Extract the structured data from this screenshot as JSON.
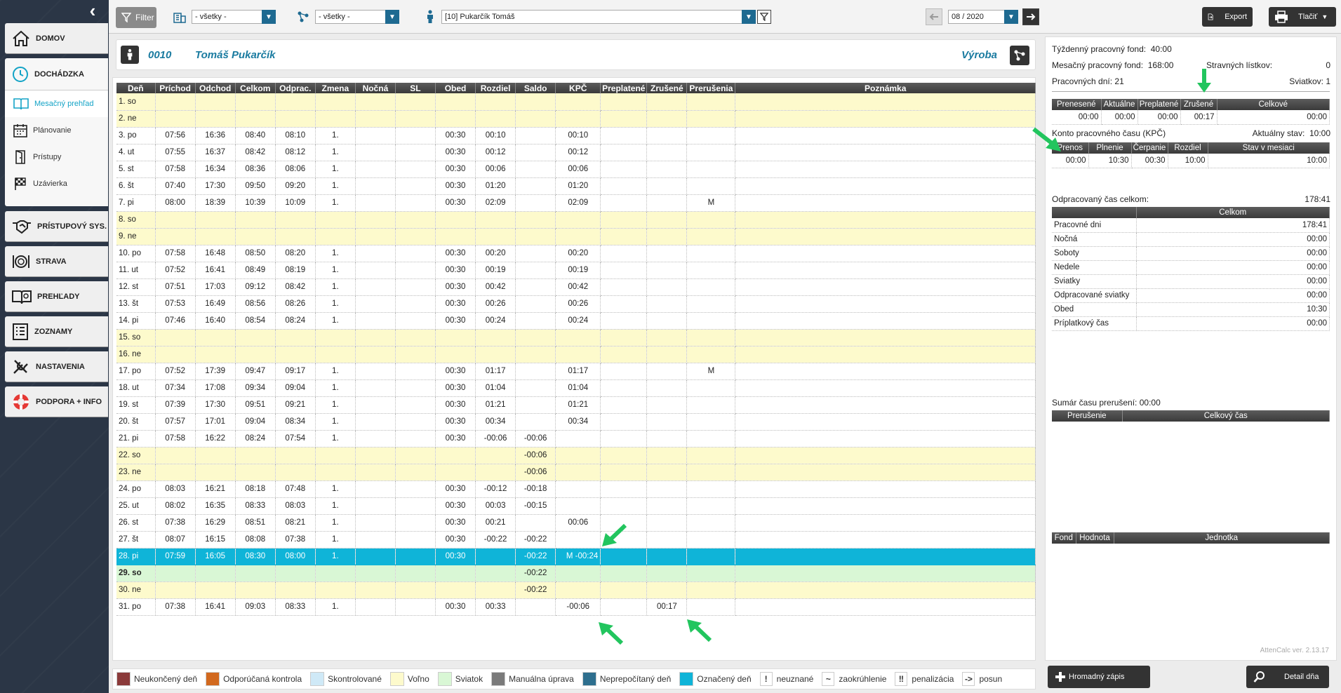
{
  "sidebar": {
    "home": "DOMOV",
    "attendance": "DOCHÁDZKA",
    "sub": [
      "Mesačný prehľad",
      "Plánovanie",
      "Prístupy",
      "Uzávierka"
    ],
    "access_system": "PRÍSTUPOVÝ SYS.",
    "food": "STRAVA",
    "reports": "PREHĽADY",
    "lists": "ZOZNAMY",
    "settings": "NASTAVENIA",
    "support": "PODPORA + INFO"
  },
  "toolbar": {
    "filter": "Filter",
    "org_select": "- všetky -",
    "group_select": "- všetky -",
    "employee_select": "[10] Pukarčík Tomáš",
    "period": "08 / 2020",
    "export": "Export",
    "print": "Tlačiť"
  },
  "employee": {
    "id": "0010",
    "name": "Tomáš Pukarčík",
    "dept": "Výroba"
  },
  "columns": [
    "Deň",
    "Príchod",
    "Odchod",
    "Celkom",
    "Odprac.",
    "Zmena",
    "Nočná",
    "SL",
    "Obed",
    "Rozdiel",
    "Saldo",
    "KPČ",
    "Preplatené",
    "Zrušené",
    "Prerušenia",
    "Poznámka"
  ],
  "rows": [
    {
      "t": "weekend",
      "c": [
        "1. so",
        "",
        "",
        "",
        "",
        "",
        "",
        "",
        "",
        "",
        "",
        "",
        "",
        "",
        "",
        ""
      ]
    },
    {
      "t": "weekend",
      "c": [
        "2. ne",
        "",
        "",
        "",
        "",
        "",
        "",
        "",
        "",
        "",
        "",
        "",
        "",
        "",
        "",
        ""
      ]
    },
    {
      "t": "",
      "c": [
        "3. po",
        "07:56",
        "16:36",
        "08:40",
        "08:10",
        "1.",
        "",
        "",
        "00:30",
        "00:10",
        "",
        "00:10",
        "",
        "",
        "",
        ""
      ]
    },
    {
      "t": "",
      "c": [
        "4. ut",
        "07:55",
        "16:37",
        "08:42",
        "08:12",
        "1.",
        "",
        "",
        "00:30",
        "00:12",
        "",
        "00:12",
        "",
        "",
        "",
        ""
      ]
    },
    {
      "t": "",
      "c": [
        "5. st",
        "07:58",
        "16:34",
        "08:36",
        "08:06",
        "1.",
        "",
        "",
        "00:30",
        "00:06",
        "",
        "00:06",
        "",
        "",
        "",
        ""
      ]
    },
    {
      "t": "",
      "c": [
        "6. št",
        "07:40",
        "17:30",
        "09:50",
        "09:20",
        "1.",
        "",
        "",
        "00:30",
        "01:20",
        "",
        "01:20",
        "",
        "",
        "",
        ""
      ]
    },
    {
      "t": "",
      "c": [
        "7. pi",
        "08:00",
        "18:39",
        "10:39",
        "10:09",
        "1.",
        "",
        "",
        "00:30",
        "02:09",
        "",
        "02:09",
        "",
        "",
        "M",
        ""
      ]
    },
    {
      "t": "weekend",
      "c": [
        "8. so",
        "",
        "",
        "",
        "",
        "",
        "",
        "",
        "",
        "",
        "",
        "",
        "",
        "",
        "",
        ""
      ]
    },
    {
      "t": "weekend",
      "c": [
        "9. ne",
        "",
        "",
        "",
        "",
        "",
        "",
        "",
        "",
        "",
        "",
        "",
        "",
        "",
        "",
        ""
      ]
    },
    {
      "t": "",
      "c": [
        "10. po",
        "07:58",
        "16:48",
        "08:50",
        "08:20",
        "1.",
        "",
        "",
        "00:30",
        "00:20",
        "",
        "00:20",
        "",
        "",
        "",
        ""
      ]
    },
    {
      "t": "",
      "c": [
        "11. ut",
        "07:52",
        "16:41",
        "08:49",
        "08:19",
        "1.",
        "",
        "",
        "00:30",
        "00:19",
        "",
        "00:19",
        "",
        "",
        "",
        ""
      ]
    },
    {
      "t": "",
      "c": [
        "12. st",
        "07:51",
        "17:03",
        "09:12",
        "08:42",
        "1.",
        "",
        "",
        "00:30",
        "00:42",
        "",
        "00:42",
        "",
        "",
        "",
        ""
      ]
    },
    {
      "t": "",
      "c": [
        "13. št",
        "07:53",
        "16:49",
        "08:56",
        "08:26",
        "1.",
        "",
        "",
        "00:30",
        "00:26",
        "",
        "00:26",
        "",
        "",
        "",
        ""
      ]
    },
    {
      "t": "",
      "c": [
        "14. pi",
        "07:46",
        "16:40",
        "08:54",
        "08:24",
        "1.",
        "",
        "",
        "00:30",
        "00:24",
        "",
        "00:24",
        "",
        "",
        "",
        ""
      ]
    },
    {
      "t": "weekend",
      "c": [
        "15. so",
        "",
        "",
        "",
        "",
        "",
        "",
        "",
        "",
        "",
        "",
        "",
        "",
        "",
        "",
        ""
      ]
    },
    {
      "t": "weekend",
      "c": [
        "16. ne",
        "",
        "",
        "",
        "",
        "",
        "",
        "",
        "",
        "",
        "",
        "",
        "",
        "",
        "",
        ""
      ]
    },
    {
      "t": "",
      "c": [
        "17. po",
        "07:52",
        "17:39",
        "09:47",
        "09:17",
        "1.",
        "",
        "",
        "00:30",
        "01:17",
        "",
        "01:17",
        "",
        "",
        "M",
        ""
      ]
    },
    {
      "t": "",
      "c": [
        "18. ut",
        "07:34",
        "17:08",
        "09:34",
        "09:04",
        "1.",
        "",
        "",
        "00:30",
        "01:04",
        "",
        "01:04",
        "",
        "",
        "",
        ""
      ]
    },
    {
      "t": "",
      "c": [
        "19. st",
        "07:39",
        "17:30",
        "09:51",
        "09:21",
        "1.",
        "",
        "",
        "00:30",
        "01:21",
        "",
        "01:21",
        "",
        "",
        "",
        ""
      ]
    },
    {
      "t": "",
      "c": [
        "20. št",
        "07:57",
        "17:01",
        "09:04",
        "08:34",
        "1.",
        "",
        "",
        "00:30",
        "00:34",
        "",
        "00:34",
        "",
        "",
        "",
        ""
      ]
    },
    {
      "t": "",
      "c": [
        "21. pi",
        "07:58",
        "16:22",
        "08:24",
        "07:54",
        "1.",
        "",
        "",
        "00:30",
        "-00:06",
        "-00:06",
        "",
        "",
        "",
        "",
        ""
      ]
    },
    {
      "t": "weekend",
      "c": [
        "22. so",
        "",
        "",
        "",
        "",
        "",
        "",
        "",
        "",
        "",
        "-00:06",
        "",
        "",
        "",
        "",
        ""
      ]
    },
    {
      "t": "weekend",
      "c": [
        "23. ne",
        "",
        "",
        "",
        "",
        "",
        "",
        "",
        "",
        "",
        "-00:06",
        "",
        "",
        "",
        "",
        ""
      ]
    },
    {
      "t": "",
      "c": [
        "24. po",
        "08:03",
        "16:21",
        "08:18",
        "07:48",
        "1.",
        "",
        "",
        "00:30",
        "-00:12",
        "-00:18",
        "",
        "",
        "",
        "",
        ""
      ]
    },
    {
      "t": "",
      "c": [
        "25. ut",
        "08:02",
        "16:35",
        "08:33",
        "08:03",
        "1.",
        "",
        "",
        "00:30",
        "00:03",
        "-00:15",
        "",
        "",
        "",
        "",
        ""
      ]
    },
    {
      "t": "",
      "c": [
        "26. st",
        "07:38",
        "16:29",
        "08:51",
        "08:21",
        "1.",
        "",
        "",
        "00:30",
        "00:21",
        "",
        "00:06",
        "",
        "",
        "",
        ""
      ]
    },
    {
      "t": "",
      "c": [
        "27. št",
        "08:07",
        "16:15",
        "08:08",
        "07:38",
        "1.",
        "",
        "",
        "00:30",
        "-00:22",
        "-00:22",
        "",
        "",
        "",
        "",
        ""
      ]
    },
    {
      "t": "sel",
      "c": [
        "28. pi",
        "07:59",
        "16:05",
        "08:30",
        "08:00",
        "1.",
        "",
        "",
        "00:30",
        "",
        "-00:22",
        "M   -00:24",
        "",
        "",
        "",
        ""
      ]
    },
    {
      "t": "holiday",
      "c": [
        "29. so",
        "",
        "",
        "",
        "",
        "",
        "",
        "",
        "",
        "",
        "-00:22",
        "",
        "",
        "",
        "",
        ""
      ]
    },
    {
      "t": "weekend",
      "c": [
        "30. ne",
        "",
        "",
        "",
        "",
        "",
        "",
        "",
        "",
        "",
        "-00:22",
        "",
        "",
        "",
        "",
        ""
      ]
    },
    {
      "t": "",
      "c": [
        "31. po",
        "07:38",
        "16:41",
        "09:03",
        "08:33",
        "1.",
        "",
        "",
        "00:30",
        "00:33",
        "",
        "-00:06",
        "",
        "00:17",
        "",
        ""
      ]
    }
  ],
  "legend": [
    {
      "label": "Neukončený deň",
      "color": "#8b3a3a"
    },
    {
      "label": "Odporúčaná kontrola",
      "color": "#d2691e"
    },
    {
      "label": "Skontrolované",
      "color": "#cfe9f7"
    },
    {
      "label": "Voľno",
      "color": "#fdfacc"
    },
    {
      "label": "Sviatok",
      "color": "#d9f7d5"
    },
    {
      "label": "Manuálna úprava",
      "color": "#7a7a7a"
    },
    {
      "label": "Neprepočítaný deň",
      "color": "#2e6f8e"
    },
    {
      "label": "Označený deň",
      "color": "#0fb4d8"
    }
  ],
  "legend_symbols": [
    {
      "sym": "!",
      "label": "neuznané"
    },
    {
      "sym": "~",
      "label": "zaokrúhlenie"
    },
    {
      "sym": "‼",
      "label": "penalizácia"
    },
    {
      "sym": "->",
      "label": "posun"
    }
  ],
  "summary": {
    "weekly_fund_label": "Týždenný pracovný fond:",
    "weekly_fund": "40:00",
    "monthly_fund_label": "Mesačný pracovný fond:",
    "monthly_fund": "168:00",
    "meal_label": "Stravných lístkov:",
    "meal": "0",
    "workdays_label": "Pracovných dní:",
    "workdays": "21",
    "holidays_label": "Sviatkov:",
    "holidays": "1",
    "ot_headers": [
      "Prenesené",
      "Aktuálne",
      "Preplatené",
      "Zrušené",
      "Celkové"
    ],
    "ot_values": [
      "00:00",
      "00:00",
      "00:00",
      "00:17",
      "00:00"
    ],
    "kpc_label": "Konto pracovného času (KPČ)",
    "kpc_state_label": "Aktuálny stav:",
    "kpc_state": "10:00",
    "kpc_headers": [
      "Prenos",
      "Plnenie",
      "Čerpanie",
      "Rozdiel",
      "Stav v mesiaci"
    ],
    "kpc_values": [
      "00:00",
      "10:30",
      "00:30",
      "10:00",
      "10:00"
    ],
    "worked_label": "Odpracovaný čas celkom:",
    "worked": "178:41",
    "worked_header": "Celkom",
    "worked_rows": [
      {
        "label": "Pracovné dni",
        "value": "178:41"
      },
      {
        "label": "Nočná",
        "value": "00:00"
      },
      {
        "label": "Soboty",
        "value": "00:00"
      },
      {
        "label": "Nedele",
        "value": "00:00"
      },
      {
        "label": "Sviatky",
        "value": "00:00"
      },
      {
        "label": "Odpracované sviatky",
        "value": "00:00"
      },
      {
        "label": "Obed",
        "value": "10:30"
      },
      {
        "label": "Príplatkový čas",
        "value": "00:00"
      }
    ],
    "breaks_label": "Sumár času prerušení:",
    "breaks": "00:00",
    "breaks_headers": [
      "Prerušenie",
      "Celkový čas"
    ],
    "fund_headers": [
      "Fond",
      "Hodnota",
      "Jednotka"
    ],
    "version": "AttenCalc ver. 2.13.17"
  },
  "buttons": {
    "bulk": "Hromadný zápis",
    "detail": "Detail dňa"
  },
  "colors": {
    "accent": "#13a3c6",
    "selected": "#0fb4d8",
    "weekend": "#fdfacc",
    "holiday": "#d9f7d5",
    "arrow": "#22c55e"
  }
}
